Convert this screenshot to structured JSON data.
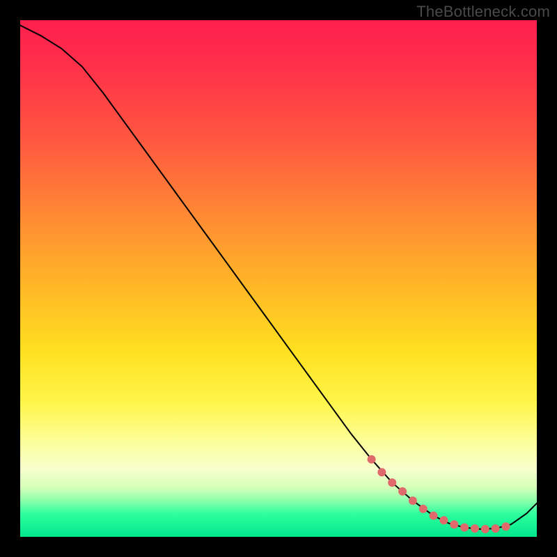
{
  "watermark": "TheBottleneck.com",
  "chart_data": {
    "type": "line",
    "title": "",
    "xlabel": "",
    "ylabel": "",
    "xlim": [
      0,
      100
    ],
    "ylim": [
      0,
      100
    ],
    "grid": false,
    "series": [
      {
        "name": "bottleneck-curve",
        "x": [
          0,
          4,
          8,
          12,
          16,
          20,
          24,
          28,
          32,
          36,
          40,
          44,
          48,
          52,
          56,
          60,
          64,
          68,
          72,
          76,
          80,
          83,
          86,
          89,
          92,
          95,
          98,
          100
        ],
        "y": [
          99,
          97,
          94.5,
          91,
          86,
          80.5,
          75,
          69.5,
          64,
          58.5,
          53,
          47.5,
          42,
          36.5,
          31,
          25.5,
          20,
          15,
          10.5,
          7,
          4.1,
          2.6,
          1.8,
          1.5,
          1.6,
          2.4,
          4.5,
          6.5
        ]
      }
    ],
    "markers": {
      "name": "highlight-dots",
      "x": [
        68,
        70,
        72,
        74,
        76,
        78,
        80,
        82,
        84,
        86,
        88,
        90,
        92,
        94
      ],
      "y": [
        15,
        12.5,
        10.5,
        8.8,
        7,
        5.4,
        4.1,
        3.2,
        2.4,
        1.8,
        1.6,
        1.5,
        1.6,
        2.0
      ]
    },
    "gradient_stops": [
      {
        "pos": 0,
        "color": "#ff1f4e"
      },
      {
        "pos": 0.38,
        "color": "#ff8a33"
      },
      {
        "pos": 0.64,
        "color": "#ffe01f"
      },
      {
        "pos": 0.87,
        "color": "#f6ffce"
      },
      {
        "pos": 1.0,
        "color": "#00e78c"
      }
    ]
  }
}
